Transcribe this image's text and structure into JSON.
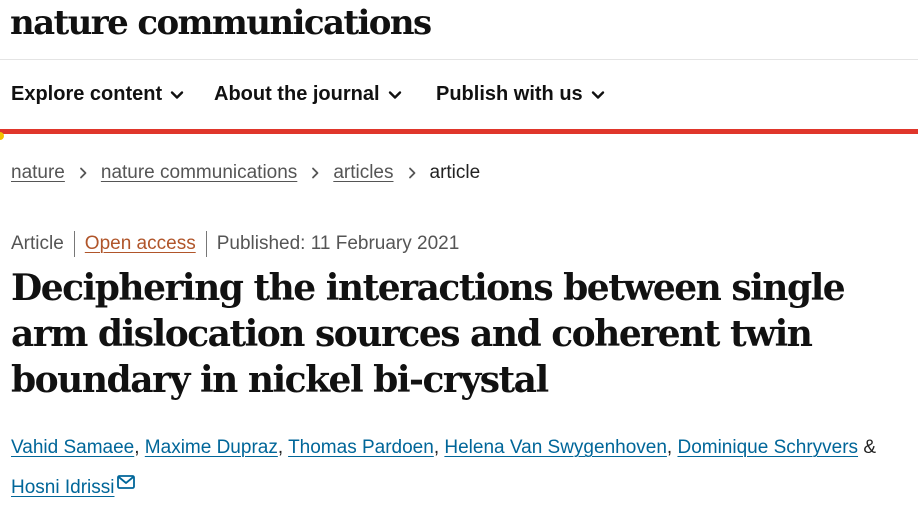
{
  "site": {
    "brand": "nature communications"
  },
  "nav": {
    "items": [
      {
        "label": "Explore content"
      },
      {
        "label": "About the journal"
      },
      {
        "label": "Publish with us"
      }
    ]
  },
  "colors": {
    "accent": "#e0362b",
    "accent_dot": "#f2c200",
    "link": "#006699",
    "open_access": "#b0552a",
    "muted": "#555555"
  },
  "breadcrumb": {
    "items": [
      {
        "label": "nature"
      },
      {
        "label": "nature communications"
      },
      {
        "label": "articles"
      }
    ],
    "current": "article"
  },
  "meta": {
    "type": "Article",
    "access": "Open access",
    "published": "Published: 11 February 2021"
  },
  "article": {
    "title": "Deciphering the interactions between single arm dislocation sources and coherent twin boundary in nickel bi-crystal"
  },
  "authors": {
    "list": [
      "Vahid Samaee",
      "Maxime Dupraz",
      "Thomas Pardoen",
      "Helena Van Swygenhoven",
      "Dominique Schryvers",
      "Hosni Idrissi"
    ],
    "separator": ",",
    "conjunction": "&",
    "corresponding_icon": "mail-icon"
  }
}
